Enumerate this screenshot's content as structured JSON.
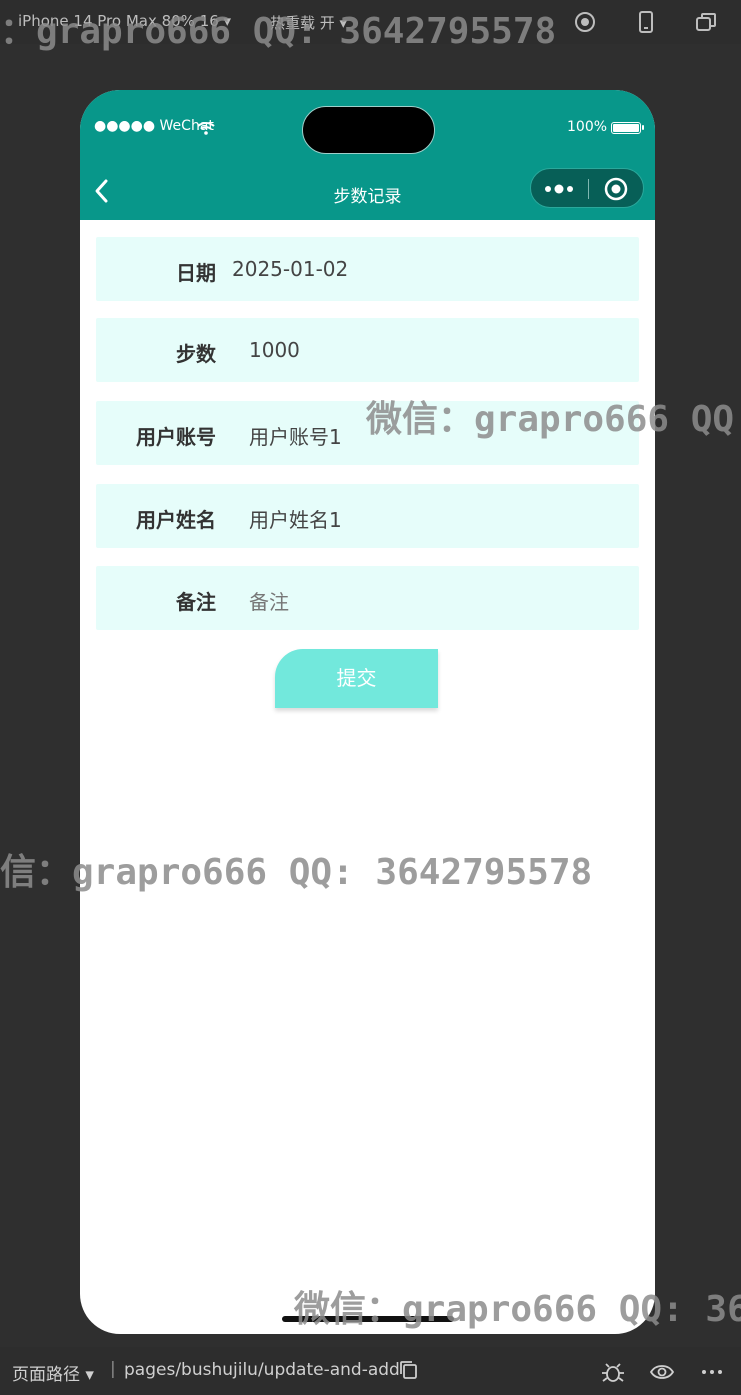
{
  "toolbar": {
    "device_label": "iPhone 14 Pro Max 80% 16 ▾",
    "reload_label": "热重载 开 ▾",
    "icons": [
      "record-icon",
      "phone-icon",
      "window-icon"
    ]
  },
  "status_bar": {
    "carrier": "●●●●● WeChat",
    "battery": "100%"
  },
  "navbar": {
    "title": "步数记录",
    "back_icon": "chevron-left-icon",
    "more_icon": "more-dots-icon",
    "close_icon": "target-icon"
  },
  "form": {
    "fields": [
      {
        "label": "日期",
        "value": "2025-01-02",
        "placeholder": false
      },
      {
        "label": "步数",
        "value": "1000",
        "placeholder": false
      },
      {
        "label": "用户账号",
        "value": "用户账号1",
        "placeholder": false
      },
      {
        "label": "用户姓名",
        "value": "用户姓名1",
        "placeholder": false
      },
      {
        "label": "备注",
        "value": "备注",
        "placeholder": true
      }
    ],
    "submit_label": "提交"
  },
  "bottom_bar": {
    "path_label": "页面路径 ▾",
    "separator": "|",
    "path": "pages/bushujilu/update-and-add"
  },
  "watermarks": [
    "：grapro666 QQ: 3642795578",
    "微信：grapro666 QQ",
    "信：grapro666 QQ: 3642795578",
    "微信：grapro666 QQ: 36"
  ],
  "colors": {
    "header": "#08978a",
    "field_bg": "#e6fdfa",
    "submit_bg": "#72e8dc",
    "frame_bg": "#2f2f2f"
  }
}
